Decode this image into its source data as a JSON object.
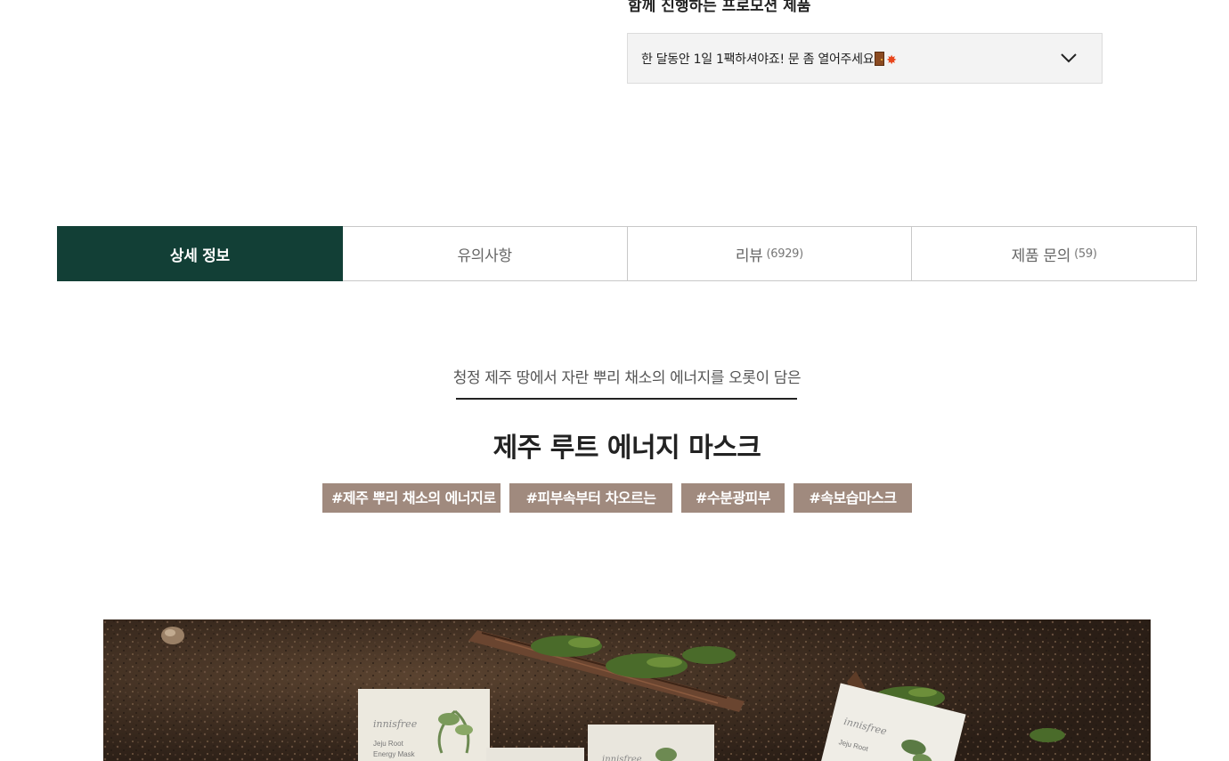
{
  "promotion": {
    "title": "함께 진행하는 프로모션 제품",
    "selected_option": "한 달동안 1일 1팩하셔야죠! 문 좀 열어주세요",
    "icons": [
      "door-icon",
      "collision-icon",
      "chevron-down-icon"
    ]
  },
  "tabs": [
    {
      "label": "상세 정보",
      "count": "",
      "active": true
    },
    {
      "label": "유의사항",
      "count": "",
      "active": false
    },
    {
      "label": "리뷰",
      "count": "(6929)",
      "active": false
    },
    {
      "label": "제품 문의",
      "count": "(59)",
      "active": false
    }
  ],
  "detail": {
    "subtitle": "청정 제주 땅에서 자란 뿌리 채소의 에너지를 오롯이 담은",
    "title": "제주 루트 에너지 마스크",
    "tags": [
      "#제주 뿌리 채소의 에너지로",
      "#피부속부터 차오르는",
      "#수분광피부",
      "#속보습마스크"
    ]
  },
  "hero_image": {
    "packs": [
      {
        "brand": "innisfree",
        "line1": "Jeju Root",
        "line2": "Energy Mask"
      },
      {
        "brand": "innisfree",
        "line1": "",
        "line2": ""
      },
      {
        "brand": "innisfree",
        "line1": "Jeju Root",
        "line2": ""
      }
    ]
  },
  "colors": {
    "active_tab": "#123f36",
    "tag_bg": "#a08a7e",
    "select_bg": "#f3f3f3"
  }
}
